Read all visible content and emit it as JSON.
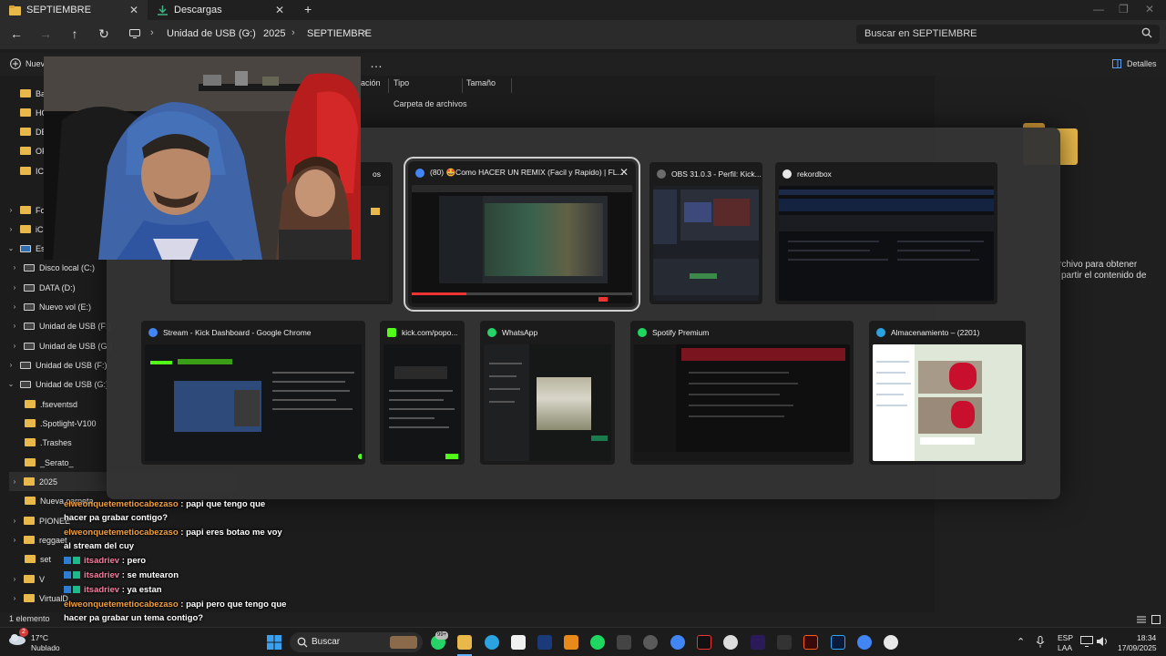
{
  "tabs": [
    {
      "label": "SEPTIEMBRE",
      "close": "✕"
    },
    {
      "label": "Descargas",
      "close": "✕"
    }
  ],
  "new_tab": "+",
  "breadcrumb": [
    "Unidad de USB (G:)",
    "2025",
    "SEPTIEMBRE"
  ],
  "search_placeholder": "Buscar en SEPTIEMBRE",
  "command_bar": {
    "new_label": "Nuev",
    "more": "…",
    "details": "Detalles"
  },
  "sidebar": [
    {
      "label": "Bas",
      "type": "folder"
    },
    {
      "label": "HO",
      "type": "folder"
    },
    {
      "label": "DE",
      "type": "folder"
    },
    {
      "label": "OF",
      "type": "folder"
    },
    {
      "label": "ICA",
      "type": "folder"
    },
    {
      "label": "Fot",
      "type": "folder",
      "chev": "›"
    },
    {
      "label": "iCl",
      "type": "folder",
      "chev": "›"
    },
    {
      "label": "Est",
      "type": "pc",
      "chev": "⌄"
    },
    {
      "label": "Disco local (C:)",
      "type": "drive",
      "chev": "›"
    },
    {
      "label": "DATA (D:)",
      "type": "drive",
      "chev": "›"
    },
    {
      "label": "Nuevo vol (E:)",
      "type": "drive",
      "chev": "›"
    },
    {
      "label": "Unidad de USB (F:)",
      "type": "drive",
      "chev": "›"
    },
    {
      "label": "Unidad de USB (G:)",
      "type": "drive",
      "chev": "›"
    },
    {
      "label": "Unidad de USB (F:)",
      "type": "drive",
      "chev": "›"
    },
    {
      "label": "Unidad de USB (G:)",
      "type": "drive",
      "chev": "⌄"
    },
    {
      "label": ".fseventsd",
      "type": "folder"
    },
    {
      "label": ".Spotlight-V100",
      "type": "folder"
    },
    {
      "label": ".Trashes",
      "type": "folder"
    },
    {
      "label": "_Serato_",
      "type": "folder"
    },
    {
      "label": "2025",
      "type": "folder",
      "chev": "›"
    },
    {
      "label": "Nueva carpeta",
      "type": "folder"
    },
    {
      "label": "PIONEE",
      "type": "folder",
      "chev": "›"
    },
    {
      "label": "reggaet",
      "type": "folder",
      "chev": "›"
    },
    {
      "label": "set",
      "type": "folder"
    },
    {
      "label": "V",
      "type": "folder",
      "chev": "›"
    },
    {
      "label": "VirtualD",
      "type": "folder",
      "chev": "›"
    }
  ],
  "columns": [
    "ación",
    "Tipo",
    "Tamaño"
  ],
  "row_type": "Carpeta de archivos",
  "details_text": [
    "rchivo para obtener",
    "partir el contenido de"
  ],
  "status": "1 elemento",
  "switcher": [
    {
      "title": "os",
      "icon_color": "#3a3a3a"
    },
    {
      "title": "(80) 🤩Como HACER UN REMIX (Facil y Rapido) | FL...",
      "icon_color": "#4285f4",
      "close": "✕"
    },
    {
      "title": "OBS 31.0.3 - Perfil: Kick...",
      "icon_color": "#6b6b6b"
    },
    {
      "title": "rekordbox",
      "icon_color": "#e8e8e8"
    },
    {
      "title": "Stream - Kick Dashboard - Google Chrome",
      "icon_color": "#4285f4"
    },
    {
      "title": "kick.com/popo...",
      "icon_color": "#53fc18"
    },
    {
      "title": "WhatsApp",
      "icon_color": "#25d366"
    },
    {
      "title": "Spotify Premium",
      "icon_color": "#1ed760"
    },
    {
      "title": "Almacenamiento – (2201)",
      "icon_color": "#2aa3e0"
    }
  ],
  "chat": [
    {
      "user": "elweonquetemetiocabezaso",
      "msg": ": papi que tengo que",
      "cont": "hacer pa grabar contigo?"
    },
    {
      "user": "elweonquetemetiocabezaso",
      "msg": ": papi eres botao me voy",
      "cont": "al stream del cuy"
    },
    {
      "user": "itsadriev",
      "msg": ": pero"
    },
    {
      "user": "itsadriev",
      "msg": ": se mutearon"
    },
    {
      "user": "itsadriev",
      "msg": ": ya estan"
    },
    {
      "user": "elweonquetemetiocabezaso",
      "msg": ": papi pero que tengo que",
      "cont": "hacer pa grabar un tema contigo?"
    }
  ],
  "taskbar": {
    "weather_temp": "17°C",
    "weather_desc": "Nublado",
    "weather_badge": "2",
    "search": "Buscar",
    "whatsapp_badge": "99+",
    "lang": "ESP",
    "layout": "LAA",
    "time": "18:34",
    "date": "17/09/2025"
  },
  "colors": {
    "folder": "#e8b84a",
    "accent": "#53fc18",
    "chat_user1": "#f0a040",
    "chat_user2": "#ff7aa0"
  }
}
